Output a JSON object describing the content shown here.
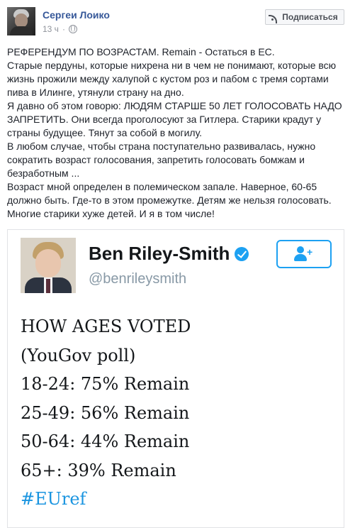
{
  "post": {
    "author": "Сергеи Лоико",
    "time": "13 ч",
    "subscribe_label": "Подписаться",
    "paragraphs": [
      "РЕФЕРЕНДУМ ПО ВОЗРАСТАМ. Remain - Остаться в ЕС.",
      "Старые пердуны, которые нихрена ни в чем не понимают, которые всю жизнь прожили между халупой с кустом роз и пабом с тремя сортами пива в Илинге, утянули страну на дно.",
      "Я давно об этом говорю: ЛЮДЯМ СТАРШЕ 50 ЛЕТ ГОЛОСОВАТЬ НАДО ЗАПРЕТИТЬ. Они всегда проголосуют за Гитлера. Старики крадут у страны будущее. Тянут за собой в могилу.",
      "В любом случае, чтобы страна поступательно развивалась, нужно сократить возраст голосования, запретить голосовать бомжам и безработным ...",
      "Возраст мной определен в полемическом запале. Наверное, 60-65 должно быть. Где-то в этом промежутке. Детям же нельзя голосовать. Многие старики хуже детей. И я в том числе!"
    ]
  },
  "tweet": {
    "name": "Ben Riley-Smith",
    "handle": "@benrileysmith",
    "lines": [
      "HOW AGES VOTED",
      "(YouGov poll)",
      "18-24: 75% Remain",
      "25-49: 56% Remain",
      "50-64: 44% Remain",
      "65+: 39% Remain"
    ],
    "hashtag": "#EUref"
  },
  "colors": {
    "link": "#365899",
    "twitter_blue": "#1da1f2",
    "hashtag": "#1b95e0"
  },
  "icons": [
    "globe-icon",
    "rss-icon",
    "verified-icon",
    "follow-user-icon"
  ]
}
